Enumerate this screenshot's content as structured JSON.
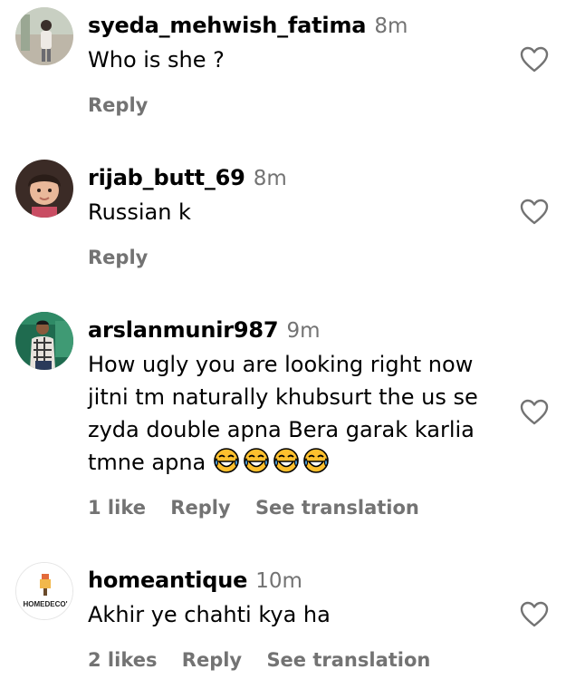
{
  "comments": [
    {
      "username": "syeda_mehwish_fatima",
      "time": "8m",
      "lines": [
        "Who is she ?"
      ],
      "likes": "",
      "reply_label": "Reply",
      "translation_label": ""
    },
    {
      "username": "rijab_butt_69",
      "time": "8m",
      "lines": [
        "Russian k"
      ],
      "likes": "",
      "reply_label": "Reply",
      "translation_label": ""
    },
    {
      "username": "arslanmunir987",
      "time": "9m",
      "lines": [
        "How ugly you are looking right now",
        "jitni tm naturally khubsurt the us se",
        "zyda double apna Bera garak karlia",
        "tmne apna"
      ],
      "emoji_count": 4,
      "emoji_name": "face-with-tears-of-joy",
      "likes": "1 like",
      "reply_label": "Reply",
      "translation_label": "See translation"
    },
    {
      "username": "homeantique",
      "time": "10m",
      "lines": [
        "Akhir ye chahti kya ha"
      ],
      "avatar_text": "HOMEDECO'",
      "likes": "2 likes",
      "reply_label": "Reply",
      "translation_label": "See translation"
    }
  ],
  "icons": {
    "like": "heart-outline-icon"
  },
  "colors": {
    "text": "#000000",
    "secondary": "#737373",
    "emoji_face": "#FDC02E",
    "emoji_tears": "#4FA3E0"
  }
}
